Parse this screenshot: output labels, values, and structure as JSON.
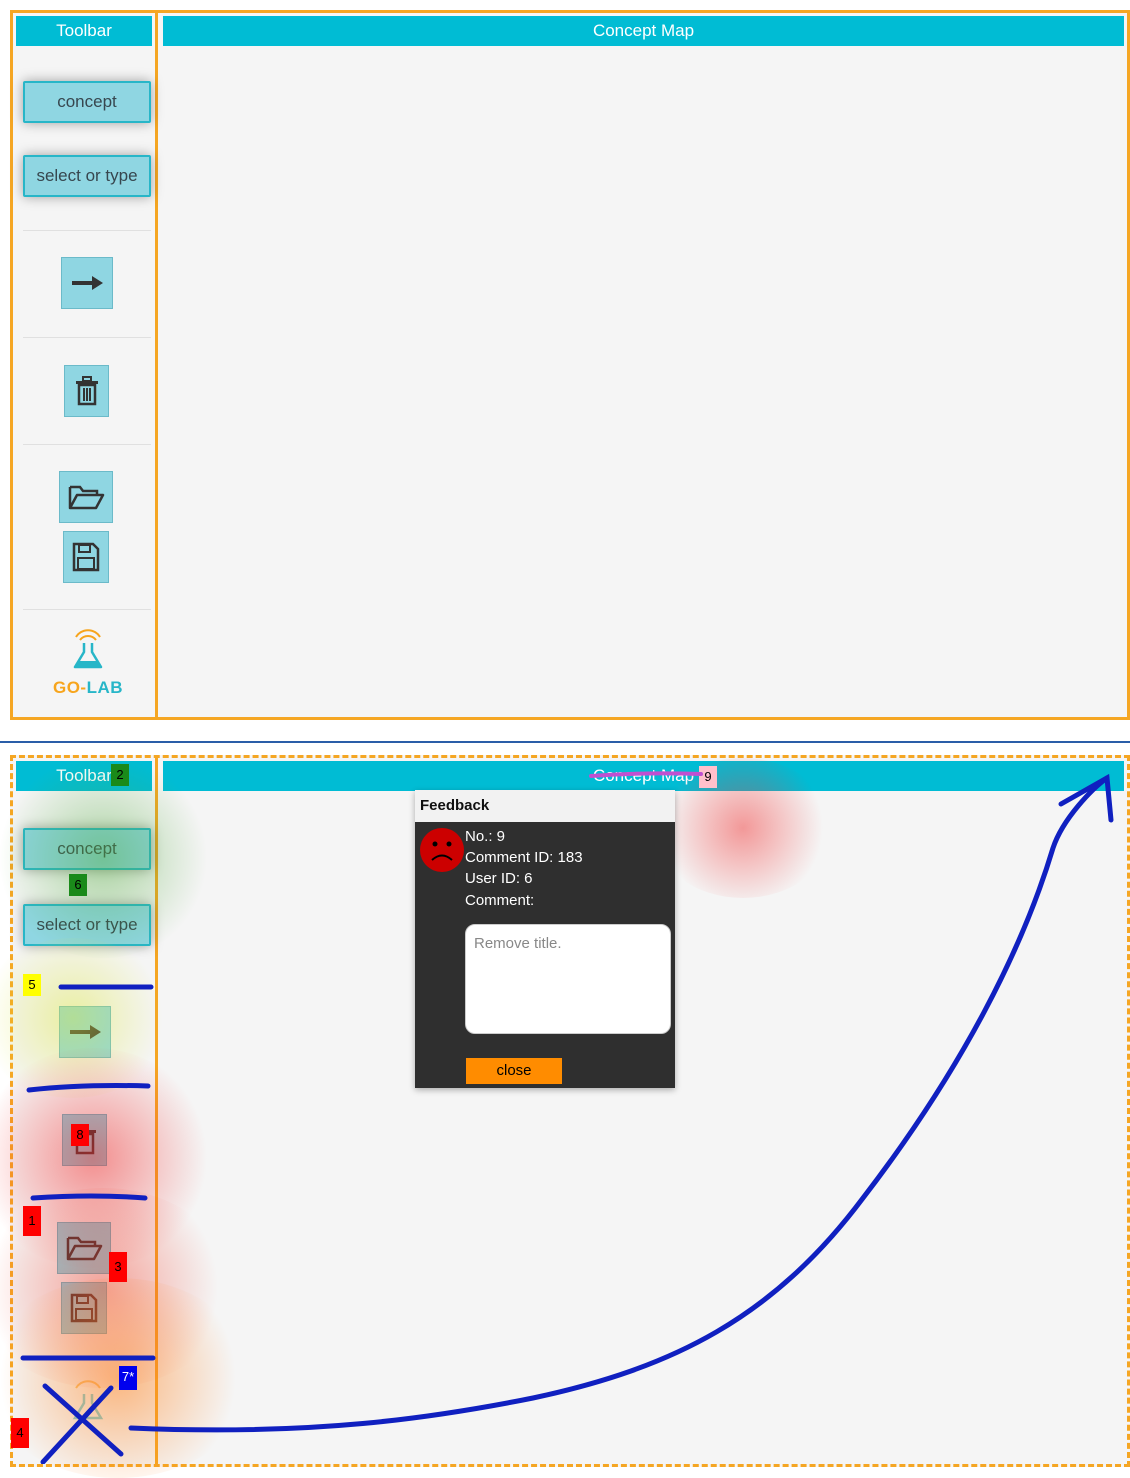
{
  "top": {
    "toolbar_title": "Toolbar",
    "map_title": "Concept Map",
    "concept_button": "concept",
    "select_button": "select or type",
    "logo_text_go": "GO-",
    "logo_text_lab": "LAB"
  },
  "bottom": {
    "toolbar_title": "Toolbar",
    "map_title": "Concept Map",
    "concept_button": "concept",
    "select_button": "select or type",
    "markers": {
      "m1": "1",
      "m2": "2",
      "m3": "3",
      "m4": "4",
      "m5": "5",
      "m6": "6",
      "m7": "7*",
      "m8": "8",
      "m9": "9"
    },
    "feedback": {
      "title": "Feedback",
      "no": "No.: 9",
      "comment_id": "Comment ID: 183",
      "user_id": "User ID: 6",
      "comment_label": "Comment:",
      "comment_text": "Remove title.",
      "close": "close"
    }
  },
  "colors": {
    "accent": "#00bcd4",
    "panel_border": "#f5a623",
    "button_fill": "#8fd6e2",
    "annotation_stroke": "#1020c0",
    "close_button": "#ff8c00",
    "feedback_bg": "#2f2f2f"
  }
}
